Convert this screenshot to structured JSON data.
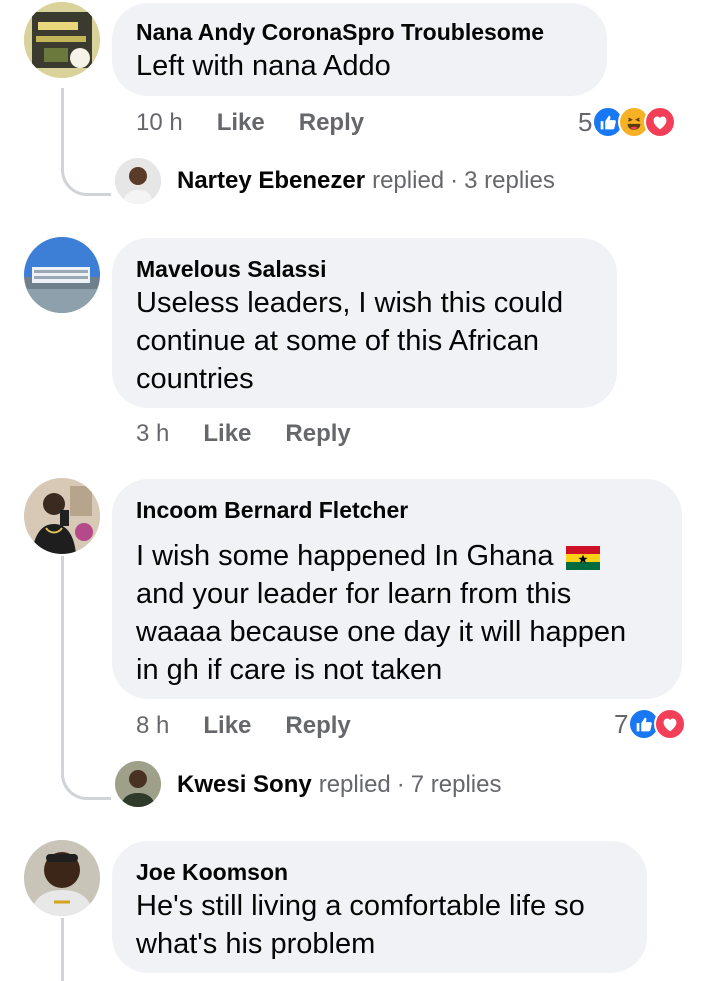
{
  "comments": [
    {
      "author": "Nana Andy CoronaSpro Troublesome",
      "text": [
        "Left with nana Addo"
      ],
      "time": "10 h",
      "like": "Like",
      "reply": "Reply",
      "reaction_count": "5",
      "reactions": [
        "like-icon",
        "haha-icon",
        "love-icon"
      ],
      "replies": {
        "name": "Nartey Ebenezer",
        "verb": "replied",
        "dot": "·",
        "count": "3 replies"
      }
    },
    {
      "author": "Mavelous Salassi",
      "text": [
        "Useless leaders, I wish this could",
        "continue at some of this African",
        "countries"
      ],
      "time": "3 h",
      "like": "Like",
      "reply": "Reply"
    },
    {
      "author": "Incoom Bernard Fletcher",
      "text": [
        "I wish some happened In Ghana",
        "and your leader for learn from this",
        "waaaa because one day it will happen",
        "in gh if care is not taken"
      ],
      "time": "8 h",
      "like": "Like",
      "reply": "Reply",
      "reaction_count": "7",
      "reactions": [
        "like-icon",
        "love-icon"
      ],
      "replies": {
        "name": "Kwesi Sony",
        "verb": "replied",
        "dot": "·",
        "count": "7 replies"
      }
    },
    {
      "author": "Joe Koomson",
      "text": [
        "He's still living a comfortable life so",
        "what's his problem"
      ]
    }
  ],
  "colors": {
    "bubble": "#f0f2f5",
    "meta": "#65676b",
    "like_blue": "#1877f2",
    "love_red": "#f33e58",
    "haha_yellow": "#f7b125"
  }
}
